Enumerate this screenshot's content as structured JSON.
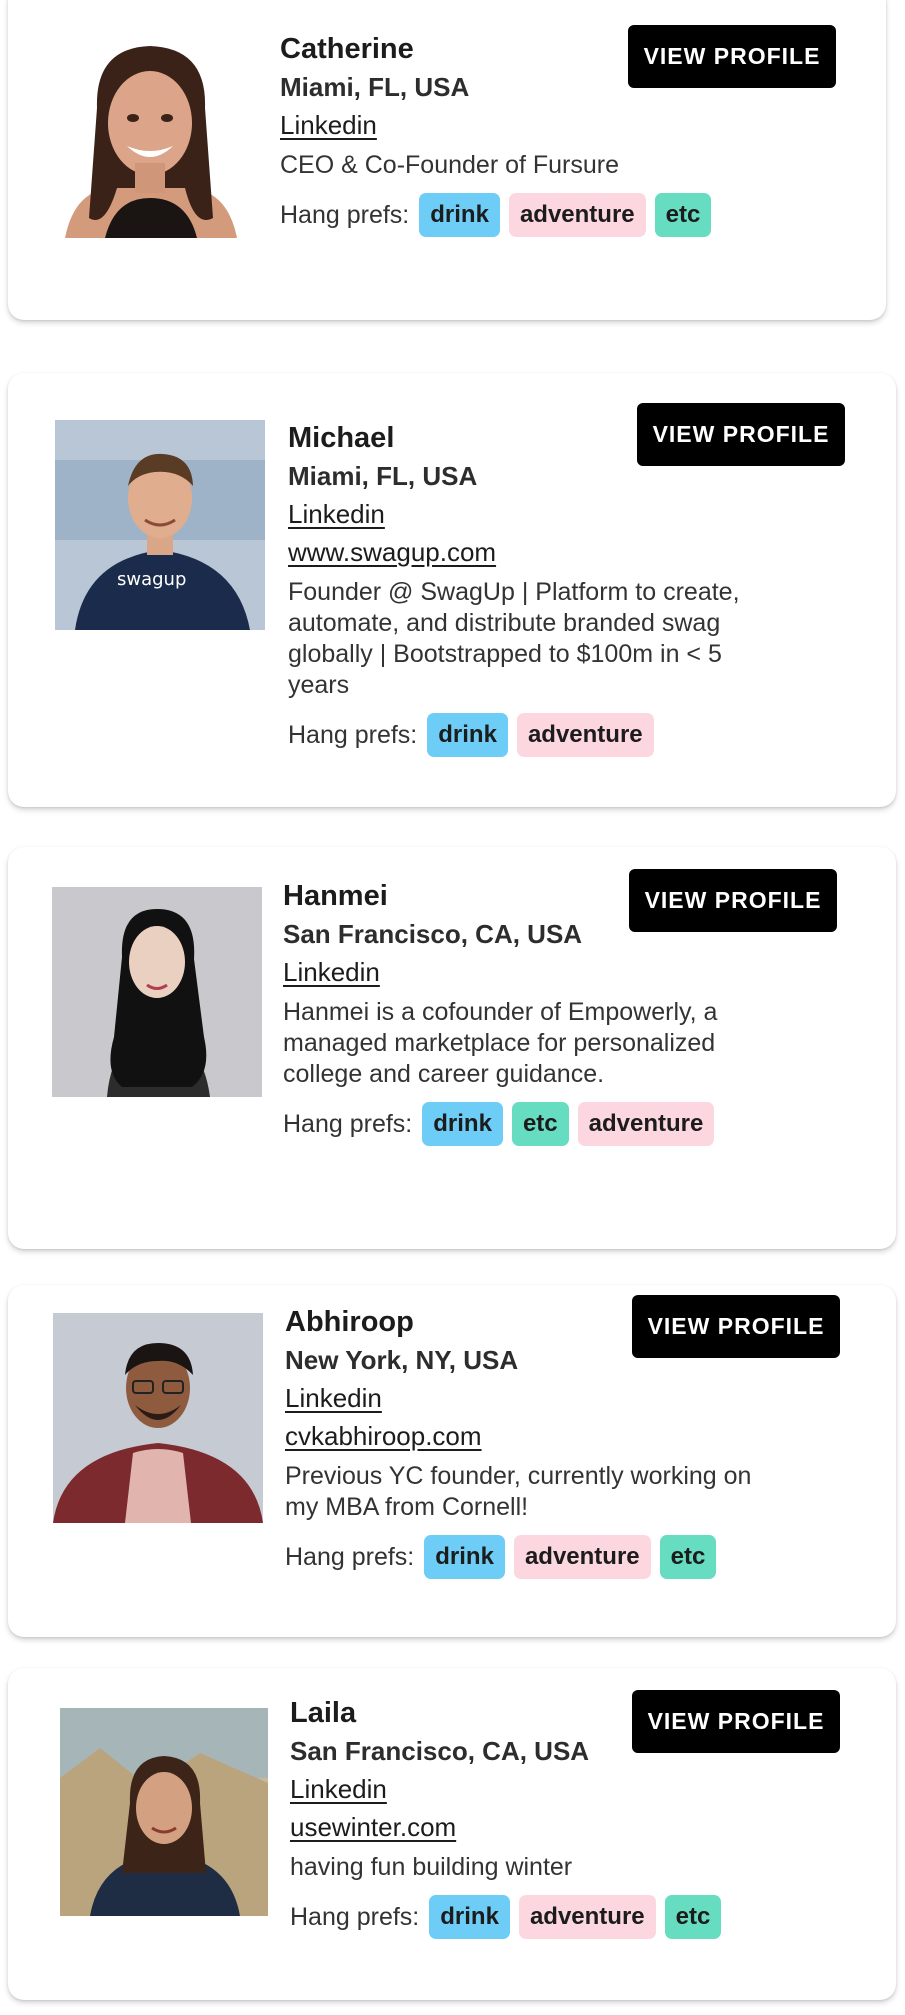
{
  "prefs_label": "Hang prefs:",
  "button_label": "VIEW PROFILE",
  "tag_colors": {
    "drink": "#6dcdf6",
    "adventure": "#fcd7e0",
    "etc": "#66dcc0"
  },
  "profiles": [
    {
      "name": "Catherine",
      "location": "Miami, FL, USA",
      "linkedin": "Linkedin",
      "website": "",
      "bio": "CEO & Co-Founder of Fursure",
      "tags": [
        "drink",
        "adventure",
        "etc"
      ]
    },
    {
      "name": "Michael",
      "location": "Miami, FL, USA",
      "linkedin": "Linkedin",
      "website": "www.swagup.com",
      "bio": "Founder @ SwagUp | Platform to create, automate, and distribute branded swag globally | Bootstrapped to $100m in < 5 years",
      "tags": [
        "drink",
        "adventure"
      ]
    },
    {
      "name": "Hanmei",
      "location": "San Francisco, CA, USA",
      "linkedin": "Linkedin",
      "website": "",
      "bio": "Hanmei is a cofounder of Empowerly, a managed marketplace for personalized college and career guidance.",
      "tags": [
        "drink",
        "etc",
        "adventure"
      ]
    },
    {
      "name": "Abhiroop",
      "location": "New York, NY, USA",
      "linkedin": "Linkedin",
      "website": "cvkabhiroop.com",
      "bio": "Previous YC founder, currently working on my MBA from Cornell!",
      "tags": [
        "drink",
        "adventure",
        "etc"
      ]
    },
    {
      "name": "Laila",
      "location": "San Francisco, CA, USA",
      "linkedin": "Linkedin",
      "website": "usewinter.com",
      "bio": "having fun building winter",
      "tags": [
        "drink",
        "adventure",
        "etc"
      ]
    }
  ]
}
